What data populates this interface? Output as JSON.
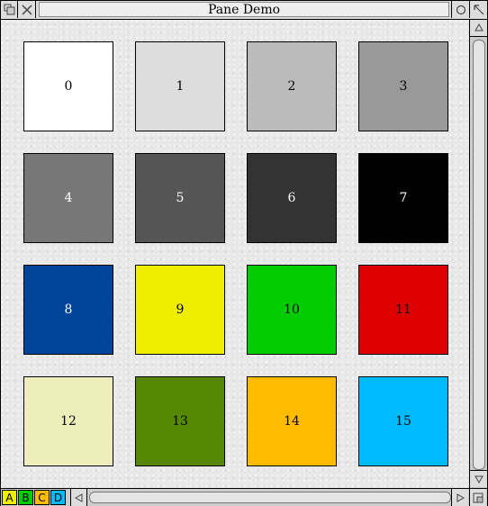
{
  "window": {
    "title": "Pane Demo"
  },
  "titlebar_icons": {
    "back": "back-icon",
    "close": "close-icon",
    "iconise": "iconise-icon",
    "toggle_size": "toggle-size-icon"
  },
  "swatches": [
    {
      "label": "0",
      "color": "#ffffff",
      "text_color": "#000000"
    },
    {
      "label": "1",
      "color": "#dddddd",
      "text_color": "#000000"
    },
    {
      "label": "2",
      "color": "#bbbbbb",
      "text_color": "#000000"
    },
    {
      "label": "3",
      "color": "#999999",
      "text_color": "#000000"
    },
    {
      "label": "4",
      "color": "#777777",
      "text_color": "#ffffff"
    },
    {
      "label": "5",
      "color": "#555555",
      "text_color": "#ffffff"
    },
    {
      "label": "6",
      "color": "#333333",
      "text_color": "#ffffff"
    },
    {
      "label": "7",
      "color": "#000000",
      "text_color": "#ffffff"
    },
    {
      "label": "8",
      "color": "#004499",
      "text_color": "#ffffff"
    },
    {
      "label": "9",
      "color": "#eeee00",
      "text_color": "#000000"
    },
    {
      "label": "10",
      "color": "#00cc00",
      "text_color": "#000000"
    },
    {
      "label": "11",
      "color": "#dd0000",
      "text_color": "#000000"
    },
    {
      "label": "12",
      "color": "#eeeebb",
      "text_color": "#000000"
    },
    {
      "label": "13",
      "color": "#558800",
      "text_color": "#000000"
    },
    {
      "label": "14",
      "color": "#ffbb00",
      "text_color": "#000000"
    },
    {
      "label": "15",
      "color": "#00bbff",
      "text_color": "#000000"
    }
  ],
  "pane_buttons": [
    {
      "label": "A",
      "color": "#eeee00"
    },
    {
      "label": "B",
      "color": "#00cc00"
    },
    {
      "label": "C",
      "color": "#ffbb00"
    },
    {
      "label": "D",
      "color": "#00bbff"
    }
  ]
}
